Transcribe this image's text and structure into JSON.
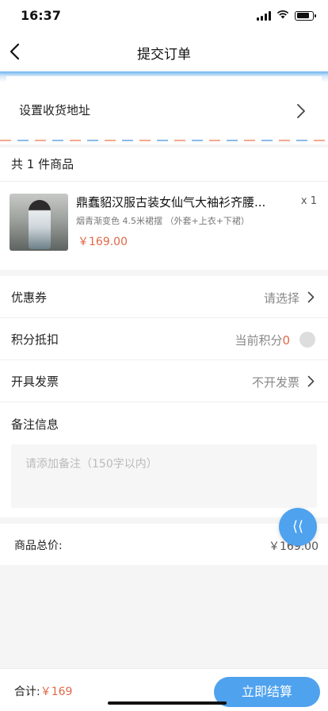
{
  "status_bar": {
    "time": "16:37"
  },
  "nav": {
    "title": "提交订单",
    "back_icon": "chevron-left-icon"
  },
  "address": {
    "label": "设置收货地址"
  },
  "goods": {
    "count_label": "共 1 件商品",
    "items": [
      {
        "name": "鼎蠢貂汉服古装女仙气大袖衫齐腰...",
        "quantity": "x 1",
        "spec": "烟青渐变色 4.5米裙摆 （外套+上衣+下裙）",
        "price": "￥169.00"
      }
    ]
  },
  "options": {
    "coupon": {
      "label": "优惠券",
      "value": "请选择"
    },
    "points": {
      "label": "积分抵扣",
      "value_prefix": "当前积分",
      "value_points": "0"
    },
    "invoice": {
      "label": "开具发票",
      "value": "不开发票"
    },
    "remark": {
      "label": "备注信息",
      "placeholder": "请添加备注（150字以内）"
    }
  },
  "total": {
    "label": "商品总价:",
    "value": "￥169.00"
  },
  "fab": {
    "icon": "collapse-arrow-icon",
    "glyph": "⟨⟨"
  },
  "bottom_bar": {
    "sum_label": "合计:",
    "sum_value": "￥169",
    "submit_label": "立即结算"
  },
  "colors": {
    "accent": "#4ea2ee",
    "price": "#e06848"
  }
}
